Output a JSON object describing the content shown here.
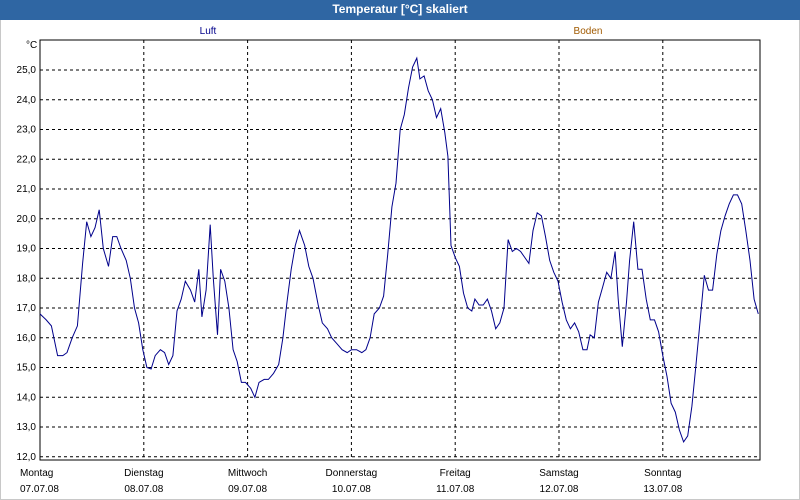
{
  "window": {
    "title": "Temperatur [°C] skaliert"
  },
  "chart_data": {
    "type": "line",
    "title": "Temperatur [°C] skaliert",
    "ylabel": "°C",
    "ylim": [
      11.8,
      26.0
    ],
    "y_ticks": [
      "25,0",
      "24,0",
      "23,0",
      "22,0",
      "21,0",
      "20,0",
      "19,0",
      "18,0",
      "17,0",
      "16,0",
      "15,0",
      "14,0",
      "13,0",
      "12,0"
    ],
    "y_tick_values": [
      25,
      24,
      23,
      22,
      21,
      20,
      19,
      18,
      17,
      16,
      15,
      14,
      13,
      12
    ],
    "x_unit": "days since 07.07.08 00:00",
    "xlim": [
      0,
      7.0
    ],
    "x_ticks": [
      {
        "x": 0,
        "day": "Montag",
        "date": "07.07.08"
      },
      {
        "x": 1,
        "day": "Dienstag",
        "date": "08.07.08"
      },
      {
        "x": 2,
        "day": "Mittwoch",
        "date": "09.07.08"
      },
      {
        "x": 3,
        "day": "Donnerstag",
        "date": "10.07.08"
      },
      {
        "x": 4,
        "day": "Freitag",
        "date": "11.07.08"
      },
      {
        "x": 5,
        "day": "Samstag",
        "date": "12.07.08"
      },
      {
        "x": 6,
        "day": "Sonntag",
        "date": "13.07.08"
      }
    ],
    "grid": true,
    "legend_position": "top",
    "series": [
      {
        "name": "Luft",
        "color": "#00008b",
        "points": [
          [
            0.0,
            16.8
          ],
          [
            0.06,
            16.6
          ],
          [
            0.11,
            16.4
          ],
          [
            0.17,
            15.4
          ],
          [
            0.22,
            15.4
          ],
          [
            0.26,
            15.5
          ],
          [
            0.31,
            16.0
          ],
          [
            0.36,
            16.4
          ],
          [
            0.41,
            18.5
          ],
          [
            0.45,
            19.9
          ],
          [
            0.49,
            19.4
          ],
          [
            0.53,
            19.7
          ],
          [
            0.57,
            20.3
          ],
          [
            0.61,
            19.0
          ],
          [
            0.66,
            18.4
          ],
          [
            0.7,
            19.4
          ],
          [
            0.74,
            19.4
          ],
          [
            0.78,
            19.0
          ],
          [
            0.83,
            18.6
          ],
          [
            0.87,
            18.0
          ],
          [
            0.91,
            17.0
          ],
          [
            0.95,
            16.5
          ],
          [
            0.99,
            15.6
          ],
          [
            1.03,
            15.0
          ],
          [
            1.07,
            14.95
          ],
          [
            1.11,
            15.4
          ],
          [
            1.16,
            15.6
          ],
          [
            1.2,
            15.5
          ],
          [
            1.24,
            15.1
          ],
          [
            1.28,
            15.4
          ],
          [
            1.32,
            16.9
          ],
          [
            1.36,
            17.3
          ],
          [
            1.4,
            17.9
          ],
          [
            1.45,
            17.6
          ],
          [
            1.49,
            17.2
          ],
          [
            1.53,
            18.3
          ],
          [
            1.56,
            16.7
          ],
          [
            1.6,
            17.6
          ],
          [
            1.64,
            19.8
          ],
          [
            1.67,
            18.0
          ],
          [
            1.71,
            16.1
          ],
          [
            1.74,
            18.3
          ],
          [
            1.78,
            17.9
          ],
          [
            1.82,
            17.0
          ],
          [
            1.86,
            15.6
          ],
          [
            1.9,
            15.2
          ],
          [
            1.94,
            14.5
          ],
          [
            1.98,
            14.5
          ],
          [
            2.03,
            14.3
          ],
          [
            2.07,
            14.0
          ],
          [
            2.11,
            14.5
          ],
          [
            2.16,
            14.6
          ],
          [
            2.2,
            14.6
          ],
          [
            2.25,
            14.8
          ],
          [
            2.3,
            15.1
          ],
          [
            2.34,
            16.0
          ],
          [
            2.38,
            17.2
          ],
          [
            2.42,
            18.3
          ],
          [
            2.46,
            19.1
          ],
          [
            2.5,
            19.6
          ],
          [
            2.55,
            19.1
          ],
          [
            2.59,
            18.4
          ],
          [
            2.63,
            18.0
          ],
          [
            2.68,
            17.1
          ],
          [
            2.72,
            16.5
          ],
          [
            2.77,
            16.3
          ],
          [
            2.81,
            16.0
          ],
          [
            2.86,
            15.8
          ],
          [
            2.91,
            15.6
          ],
          [
            2.96,
            15.5
          ],
          [
            3.0,
            15.6
          ],
          [
            3.05,
            15.6
          ],
          [
            3.1,
            15.5
          ],
          [
            3.14,
            15.6
          ],
          [
            3.18,
            16.0
          ],
          [
            3.22,
            16.8
          ],
          [
            3.27,
            17.0
          ],
          [
            3.31,
            17.4
          ],
          [
            3.35,
            18.8
          ],
          [
            3.39,
            20.4
          ],
          [
            3.43,
            21.2
          ],
          [
            3.47,
            23.0
          ],
          [
            3.51,
            23.5
          ],
          [
            3.55,
            24.4
          ],
          [
            3.59,
            25.1
          ],
          [
            3.63,
            25.4
          ],
          [
            3.66,
            24.7
          ],
          [
            3.7,
            24.8
          ],
          [
            3.74,
            24.3
          ],
          [
            3.78,
            24.0
          ],
          [
            3.82,
            23.4
          ],
          [
            3.86,
            23.7
          ],
          [
            3.9,
            22.9
          ],
          [
            3.93,
            22.1
          ],
          [
            3.96,
            19.1
          ],
          [
            4.0,
            18.7
          ],
          [
            4.04,
            18.4
          ],
          [
            4.08,
            17.5
          ],
          [
            4.12,
            17.0
          ],
          [
            4.16,
            16.9
          ],
          [
            4.19,
            17.3
          ],
          [
            4.23,
            17.1
          ],
          [
            4.27,
            17.1
          ],
          [
            4.31,
            17.3
          ],
          [
            4.35,
            16.9
          ],
          [
            4.39,
            16.3
          ],
          [
            4.43,
            16.5
          ],
          [
            4.47,
            17.0
          ],
          [
            4.51,
            19.3
          ],
          [
            4.55,
            18.9
          ],
          [
            4.59,
            19.0
          ],
          [
            4.63,
            18.9
          ],
          [
            4.67,
            18.7
          ],
          [
            4.71,
            18.5
          ],
          [
            4.75,
            19.6
          ],
          [
            4.79,
            20.2
          ],
          [
            4.83,
            20.1
          ],
          [
            4.87,
            19.4
          ],
          [
            4.91,
            18.6
          ],
          [
            4.95,
            18.2
          ],
          [
            4.99,
            17.9
          ],
          [
            5.03,
            17.2
          ],
          [
            5.07,
            16.6
          ],
          [
            5.11,
            16.3
          ],
          [
            5.15,
            16.5
          ],
          [
            5.19,
            16.2
          ],
          [
            5.23,
            15.6
          ],
          [
            5.27,
            15.6
          ],
          [
            5.3,
            16.1
          ],
          [
            5.34,
            16.0
          ],
          [
            5.38,
            17.2
          ],
          [
            5.42,
            17.7
          ],
          [
            5.46,
            18.2
          ],
          [
            5.5,
            18.0
          ],
          [
            5.54,
            18.9
          ],
          [
            5.57,
            17.3
          ],
          [
            5.61,
            15.7
          ],
          [
            5.65,
            17.2
          ],
          [
            5.68,
            18.6
          ],
          [
            5.72,
            19.9
          ],
          [
            5.76,
            18.3
          ],
          [
            5.8,
            18.3
          ],
          [
            5.84,
            17.3
          ],
          [
            5.88,
            16.6
          ],
          [
            5.92,
            16.6
          ],
          [
            5.96,
            16.2
          ],
          [
            6.0,
            15.4
          ],
          [
            6.04,
            14.7
          ],
          [
            6.08,
            13.8
          ],
          [
            6.12,
            13.5
          ],
          [
            6.16,
            12.9
          ],
          [
            6.2,
            12.5
          ],
          [
            6.24,
            12.7
          ],
          [
            6.28,
            13.7
          ],
          [
            6.32,
            15.1
          ],
          [
            6.36,
            16.6
          ],
          [
            6.4,
            18.1
          ],
          [
            6.44,
            17.6
          ],
          [
            6.48,
            17.6
          ],
          [
            6.52,
            18.8
          ],
          [
            6.56,
            19.6
          ],
          [
            6.6,
            20.1
          ],
          [
            6.64,
            20.5
          ],
          [
            6.68,
            20.8
          ],
          [
            6.72,
            20.8
          ],
          [
            6.76,
            20.5
          ],
          [
            6.8,
            19.6
          ],
          [
            6.84,
            18.6
          ],
          [
            6.88,
            17.3
          ],
          [
            6.92,
            16.8
          ]
        ]
      },
      {
        "name": "Boden",
        "color": "#a05a00",
        "points": []
      }
    ]
  }
}
